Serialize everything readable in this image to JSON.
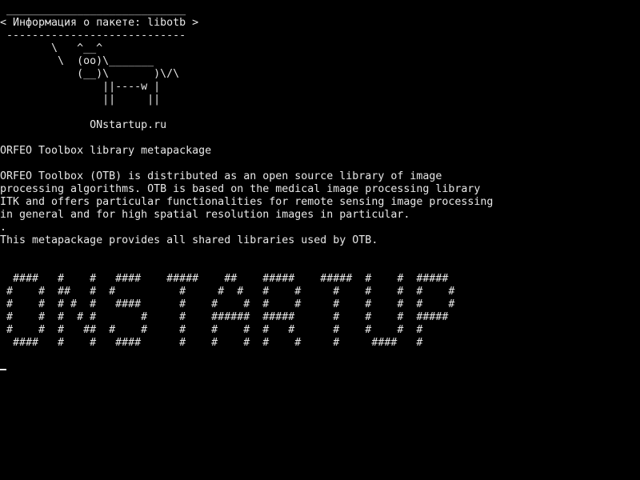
{
  "terminal": {
    "bubble_top": " ____________________________",
    "bubble_text": "< Информация о пакете: libotb >",
    "bubble_bottom": " ----------------------------",
    "cow": [
      "        \\   ^__^",
      "         \\  (oo)\\_______",
      "            (__)\\       )\\/\\",
      "                ||----w |",
      "                ||     ||"
    ],
    "site": "              ONstartup.ru",
    "summary": "ORFEO Toolbox library metapackage",
    "description": [
      "ORFEO Toolbox (OTB) is distributed as an open source library of image",
      "processing algorithms. OTB is based on the medical image processing library",
      "ITK and offers particular functionalities for remote sensing image processing",
      "in general and for high spatial resolution images in particular.",
      ".",
      "This metapackage provides all shared libraries used by OTB."
    ],
    "banner": [
      "  ####   #    #   ####    #####    ##    #####    #####  #    #  #####",
      " #    #  ##   #  #          #     #  #   #    #     #    #    #  #    #",
      " #    #  # #  #   ####      #    #    #  #    #     #    #    #  #    #",
      " #    #  #  # #       #     #    ######  #####      #    #    #  #####",
      " #    #  #   ##  #    #     #    #    #  #   #      #    #    #  #",
      "  ####   #    #   ####      #    #    #  #    #     #     ####   #"
    ]
  }
}
